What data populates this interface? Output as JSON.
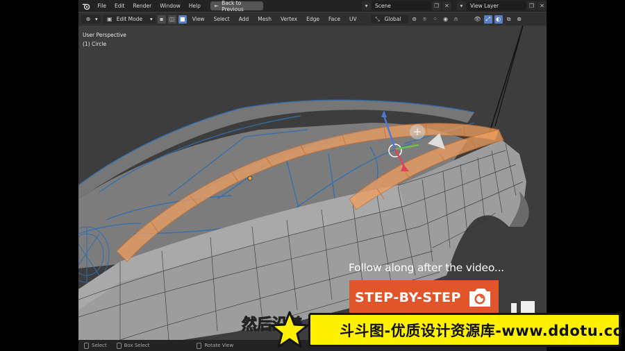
{
  "topbar": {
    "menus": [
      "File",
      "Edit",
      "Render",
      "Window",
      "Help"
    ],
    "back_label": "Back to Previous",
    "scene_label": "Scene",
    "view_layer_label": "View Layer"
  },
  "header": {
    "mode_label": "Edit Mode",
    "menus": [
      "View",
      "Select",
      "Add",
      "Mesh",
      "Vertex",
      "Edge",
      "Face",
      "UV"
    ],
    "transform_orientation": "Global"
  },
  "viewport": {
    "perspective_label": "User Perspective",
    "object_label": "(1) Circle"
  },
  "statusbar": {
    "select_label": "Select",
    "box_select_label": "Box Select",
    "rotate_label": "Rotate View"
  },
  "overlay": {
    "follow_text": "Follow along after the video...",
    "step_text": "STEP-BY-STEP",
    "subtitle_text": "然后沿着",
    "banner_text": "斗斗图-优质设计资源库-www.ddotu.com"
  },
  "colors": {
    "accent_orange": "#e1552b",
    "banner_yellow": "#fff100",
    "viewport_bg": "#3d3d3d",
    "selection_orange": "#f0a060",
    "wire_blue": "#2f6fb0"
  }
}
